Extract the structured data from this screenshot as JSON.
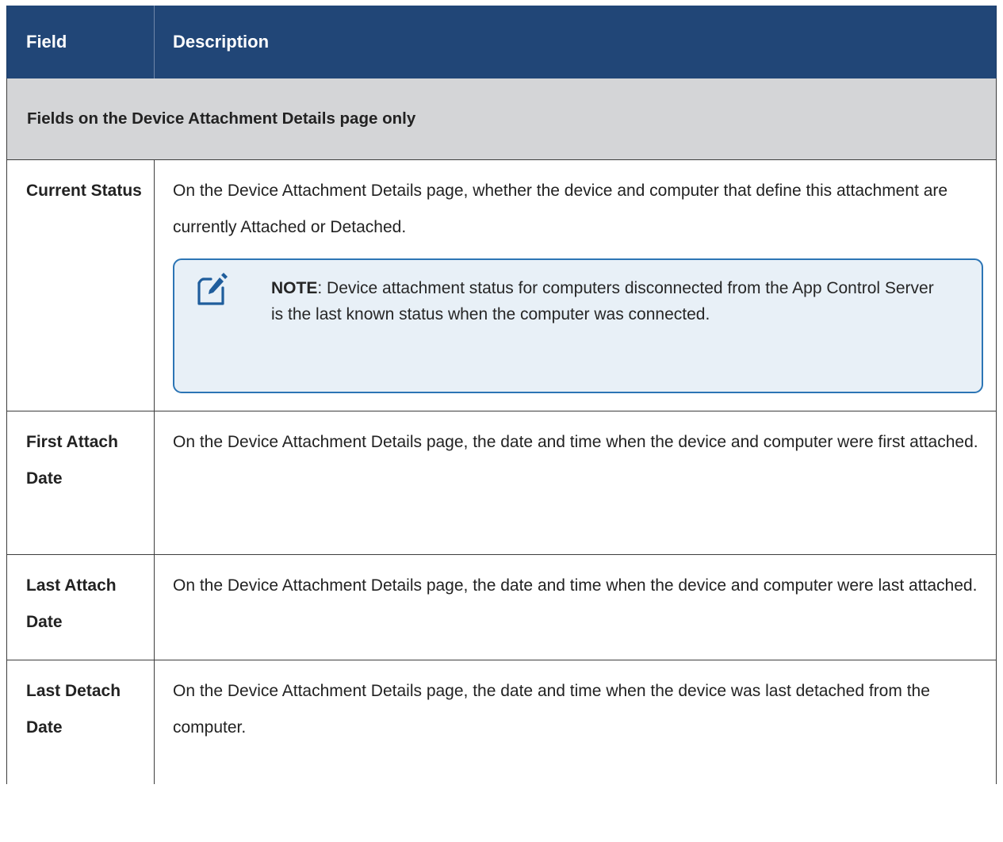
{
  "table": {
    "headers": {
      "field": "Field",
      "description": "Description"
    },
    "section_title": "Fields on the Device Attachment Details page only",
    "rows": [
      {
        "field": "Current Status",
        "description": "On the Device Attachment Details page, whether the device and computer that define this attachment are currently Attached or Detached.",
        "note": {
          "label": "NOTE",
          "separator": ":",
          "text": " Device attachment status for computers disconnected from the App Control Server is the last known status when the computer was connected.",
          "icon": "note-edit-icon",
          "border_color": "#2c75b5",
          "background_color": "#e8f0f7"
        }
      },
      {
        "field": "First Attach Date",
        "description": "On the Device Attachment Details page, the date and time when the device and computer were first attached."
      },
      {
        "field": "Last Attach Date",
        "description": "On the Device Attachment Details page, the date and time when the device and computer were last attached."
      },
      {
        "field": "Last Detach Date",
        "description": "On the Device Attachment Details page, the date and time when the device was last detached from the computer."
      }
    ]
  },
  "colors": {
    "header_background": "#214677",
    "header_text": "#ffffff",
    "section_background": "#d4d5d7",
    "border": "#3d3d3d"
  }
}
